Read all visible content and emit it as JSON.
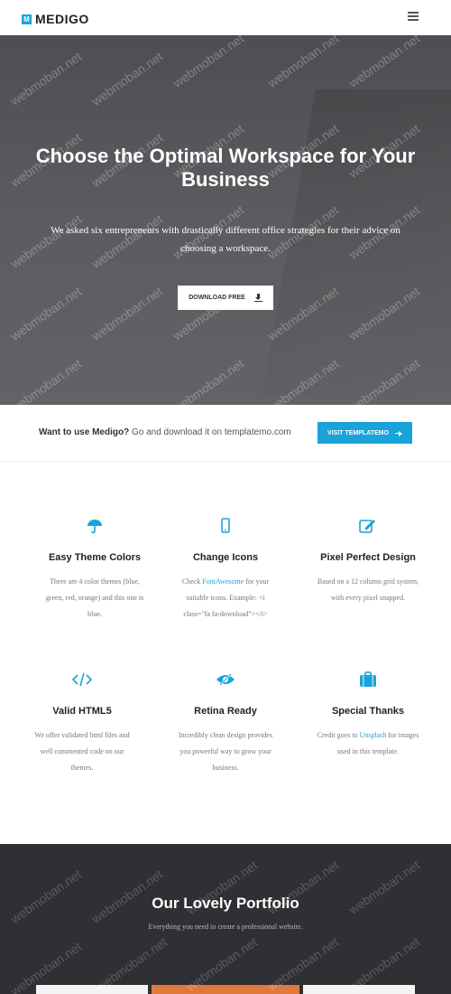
{
  "header": {
    "logo_mark": "M",
    "brand": "MEDIGO",
    "menu_icon": "hamburger-menu-icon"
  },
  "hero": {
    "title": "Choose the Optimal Workspace for Your Business",
    "subtitle": "We asked six entrepreneurs with drastically different office strategies for their advice on choosing a workspace.",
    "button_label": "DOWNLOAD FREE",
    "button_icon": "download-icon",
    "watermark": "webmoban.net"
  },
  "cta": {
    "lead": "Want to use Medigo?",
    "text": " Go and download it on templatemo.com",
    "button_label": "VISIT TEMPLATEMO",
    "button_icon": "arrow-right-icon"
  },
  "features": [
    {
      "icon": "umbrella-icon",
      "title": "Easy Theme Colors",
      "text": "There are 4 color themes (blue, green, red, orange) and this one is blue."
    },
    {
      "icon": "mobile-phone-icon",
      "title": "Change Icons",
      "pre": "Check ",
      "link": "FontAwesome",
      "post": " for your suitable icons. Example: <i class=\"fa fa-download\"></i>"
    },
    {
      "icon": "pencil-square-icon",
      "title": "Pixel Perfect Design",
      "text": "Based on a 12 column grid system, with every pixel snapped."
    },
    {
      "icon": "code-icon",
      "title": "Valid HTML5",
      "text": "We offer validated html files and well commented code on our themes."
    },
    {
      "icon": "eye-slash-icon",
      "title": "Retina Ready",
      "text": "Incredibly clean design provides you powerful way to grow your business."
    },
    {
      "icon": "briefcase-icon",
      "title": "Special Thanks",
      "pre": "Credit goes to ",
      "link": "Unsplash",
      "post": " for images used in this template."
    }
  ],
  "portfolio": {
    "title": "Our Lovely Portfolio",
    "subtitle": "Everything you need to create a professional website."
  },
  "colors": {
    "accent": "#1aa3d9",
    "hero_bg": "#56575a",
    "portfolio_bg": "#2f3033"
  }
}
